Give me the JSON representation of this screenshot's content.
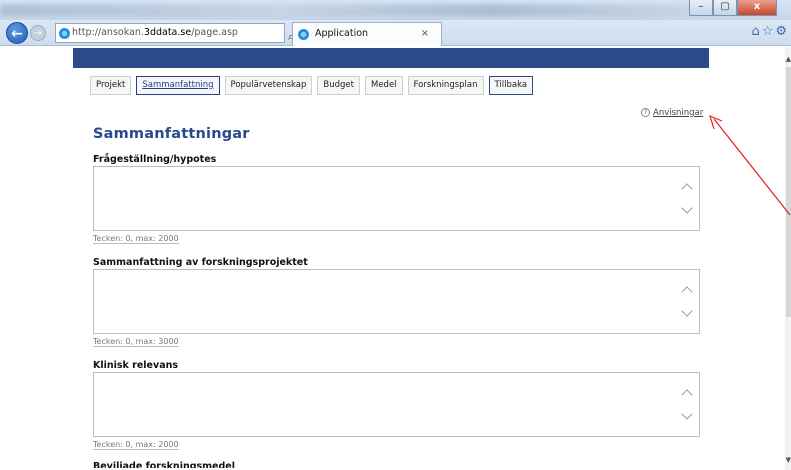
{
  "browser": {
    "url_prefix": "http://ansokan.",
    "url_host": "3ddata.se",
    "url_path": "/page.asp",
    "url_tools": "⌕ ▾ ↻",
    "tab_title": "Application",
    "tab_close": "×",
    "window_minimize": "–",
    "window_maximize": "▢",
    "window_close": "x",
    "right_tools": "⌂☆⚙"
  },
  "nav": {
    "items": [
      {
        "label": "Projekt"
      },
      {
        "label": "Sammanfattning"
      },
      {
        "label": "Populärvetenskap"
      },
      {
        "label": "Budget"
      },
      {
        "label": "Medel"
      },
      {
        "label": "Forskningsplan"
      },
      {
        "label": "Tillbaka"
      }
    ]
  },
  "help": {
    "icon_text": "?",
    "label": "Anvisningar"
  },
  "main": {
    "title": "Sammanfattningar",
    "fields": [
      {
        "label": "Frågeställning/hypotes",
        "value": "",
        "counter": "Tecken: 0, max: 2000"
      },
      {
        "label": "Sammanfattning av forskningsprojektet",
        "value": "",
        "counter": "Tecken: 0, max: 3000"
      },
      {
        "label": "Klinisk relevans",
        "value": "",
        "counter": "Tecken: 0, max: 2000"
      }
    ],
    "next_label": "Beviljade forskningsmedel"
  },
  "colors": {
    "banner": "#2d4b88",
    "title": "#264a8c",
    "arrow": "#e02020"
  }
}
